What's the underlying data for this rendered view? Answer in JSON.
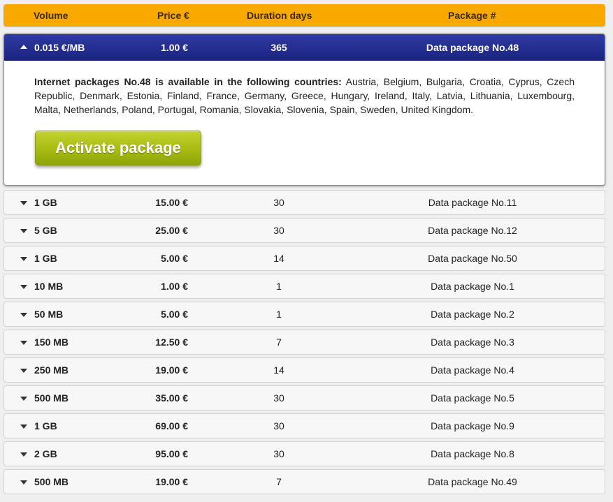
{
  "header": {
    "volume": "Volume",
    "price": "Price €",
    "duration": "Duration days",
    "package": "Package #"
  },
  "expanded": {
    "volume": "0.015 €/MB",
    "price": "1.00 €",
    "duration": "365",
    "package": "Data package No.48",
    "description_bold": "Internet packages No.48 is available in the following countries:",
    "description_text": " Austria, Belgium, Bulgaria, Croatia, Cyprus, Czech Republic, Denmark, Estonia, Finland, France, Germany, Greece, Hungary, Ireland, Italy, Latvia, Lithuania, Luxembourg, Malta, Netherlands, Poland, Portugal, Romania, Slovakia,  Slovenia, Spain, Sweden, United Kingdom.",
    "activate_label": "Activate package"
  },
  "rows": [
    {
      "volume": "1 GB",
      "price": "15.00 €",
      "duration": "30",
      "package": "Data package No.11"
    },
    {
      "volume": "5 GB",
      "price": "25.00 €",
      "duration": "30",
      "package": "Data package No.12"
    },
    {
      "volume": "1 GB",
      "price": "5.00 €",
      "duration": "14",
      "package": "Data package No.50"
    },
    {
      "volume": "10 MB",
      "price": "1.00 €",
      "duration": "1",
      "package": "Data package No.1"
    },
    {
      "volume": "50 MB",
      "price": "5.00 €",
      "duration": "1",
      "package": "Data package No.2"
    },
    {
      "volume": "150 MB",
      "price": "12.50 €",
      "duration": "7",
      "package": "Data package No.3"
    },
    {
      "volume": "250 MB",
      "price": "19.00 €",
      "duration": "14",
      "package": "Data package No.4"
    },
    {
      "volume": "500 MB",
      "price": "35.00 €",
      "duration": "30",
      "package": "Data package No.5"
    },
    {
      "volume": "1 GB",
      "price": "69.00 €",
      "duration": "30",
      "package": "Data package No.9"
    },
    {
      "volume": "2 GB",
      "price": "95.00 €",
      "duration": "30",
      "package": "Data package No.8"
    },
    {
      "volume": "500 MB",
      "price": "19.00 €",
      "duration": "7",
      "package": "Data package No.49"
    }
  ],
  "colors": {
    "header_bg": "#f9a800",
    "expanded_header_bg": "#2e3aa3",
    "activate_button": "#a7bb12"
  }
}
